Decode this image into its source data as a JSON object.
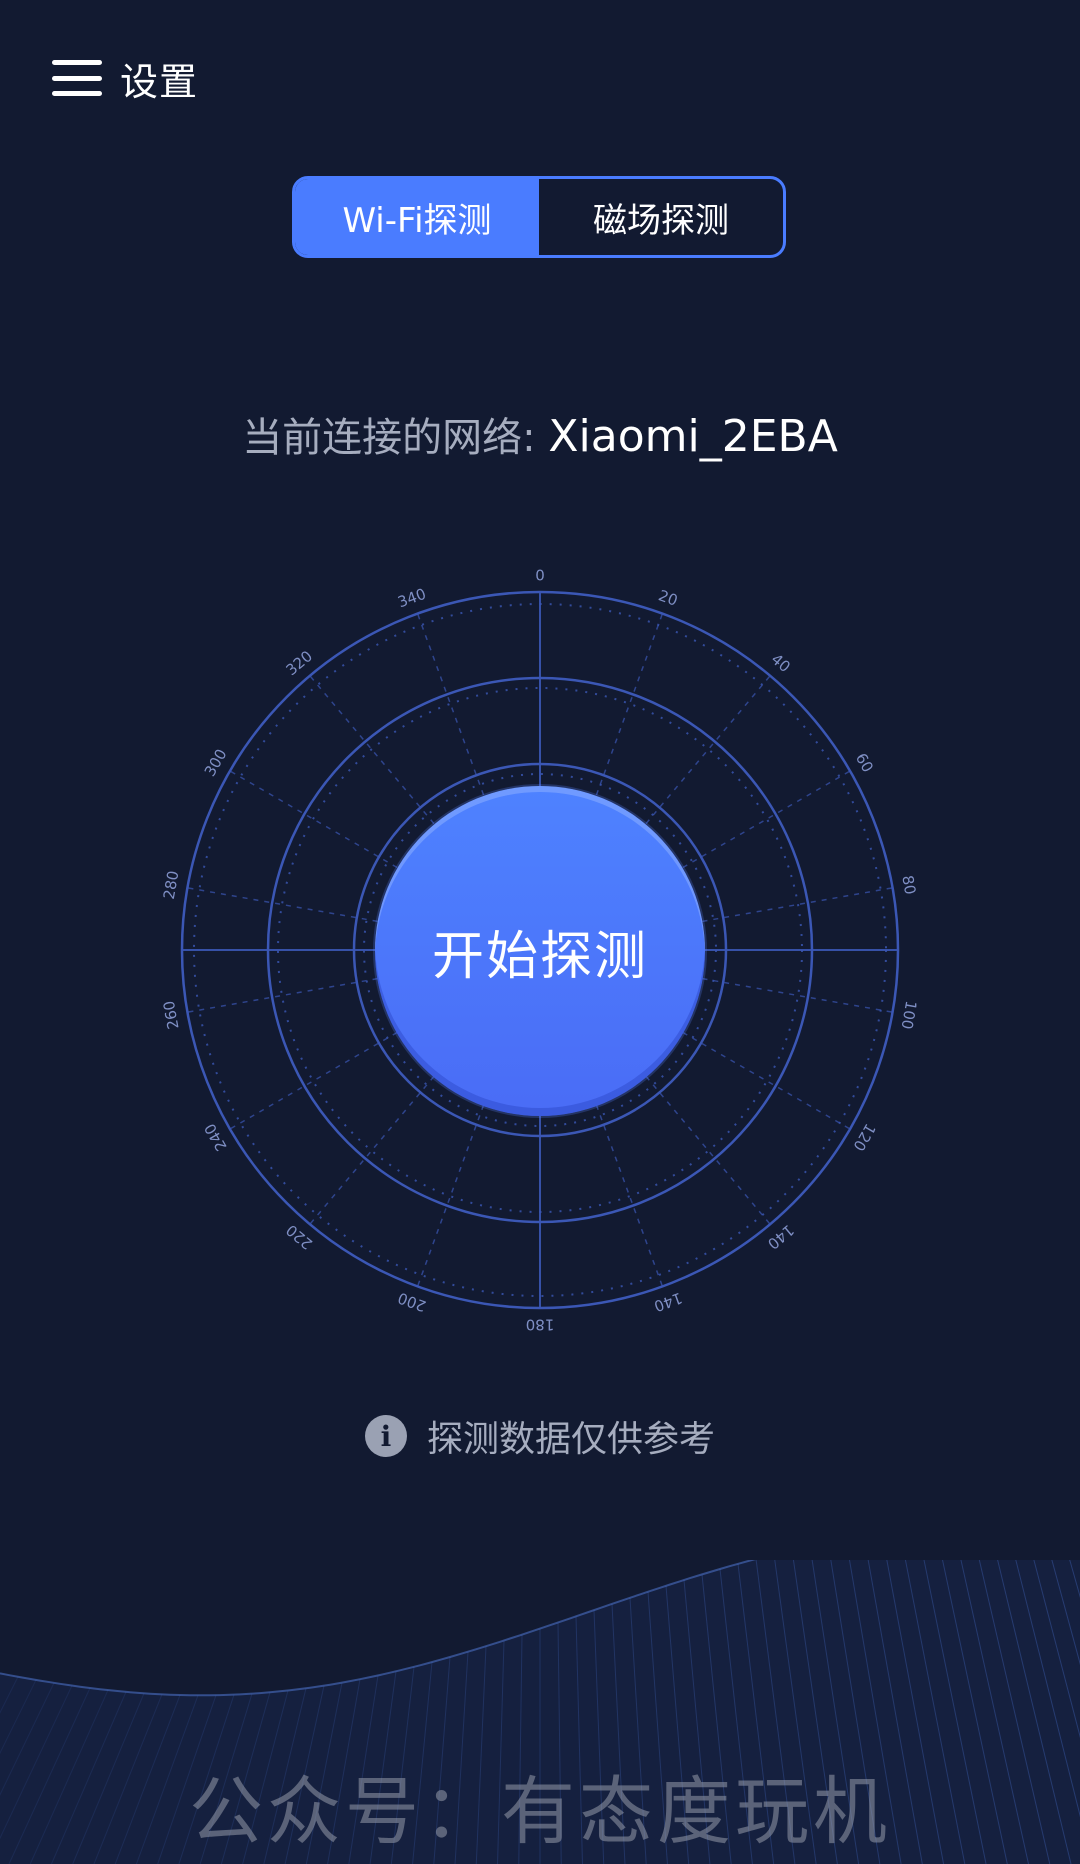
{
  "header": {
    "title": "设置",
    "menu_icon": "hamburger-menu-icon"
  },
  "tabs": [
    {
      "label": "Wi-Fi探测",
      "active": true
    },
    {
      "label": "磁场探测",
      "active": false
    }
  ],
  "network": {
    "label": "当前连接的网络: ",
    "name": "Xiaomi_2EBA"
  },
  "radar": {
    "ticks": [
      "0",
      "20",
      "40",
      "60",
      "80",
      "100",
      "120",
      "140",
      "140",
      "180",
      "200",
      "220",
      "240",
      "260",
      "280",
      "300",
      "320",
      "340"
    ],
    "tick_color": "#7f8fc4",
    "ring_color": "#3b57b5"
  },
  "start_button": {
    "label": "开始探测"
  },
  "disclaimer": {
    "icon": "info-icon",
    "text": "探测数据仅供参考"
  },
  "watermark": {
    "text": "公众号：有态度玩机"
  },
  "colors": {
    "background": "#121a31",
    "accent": "#4a7cff",
    "muted_text": "#a6adbf"
  }
}
